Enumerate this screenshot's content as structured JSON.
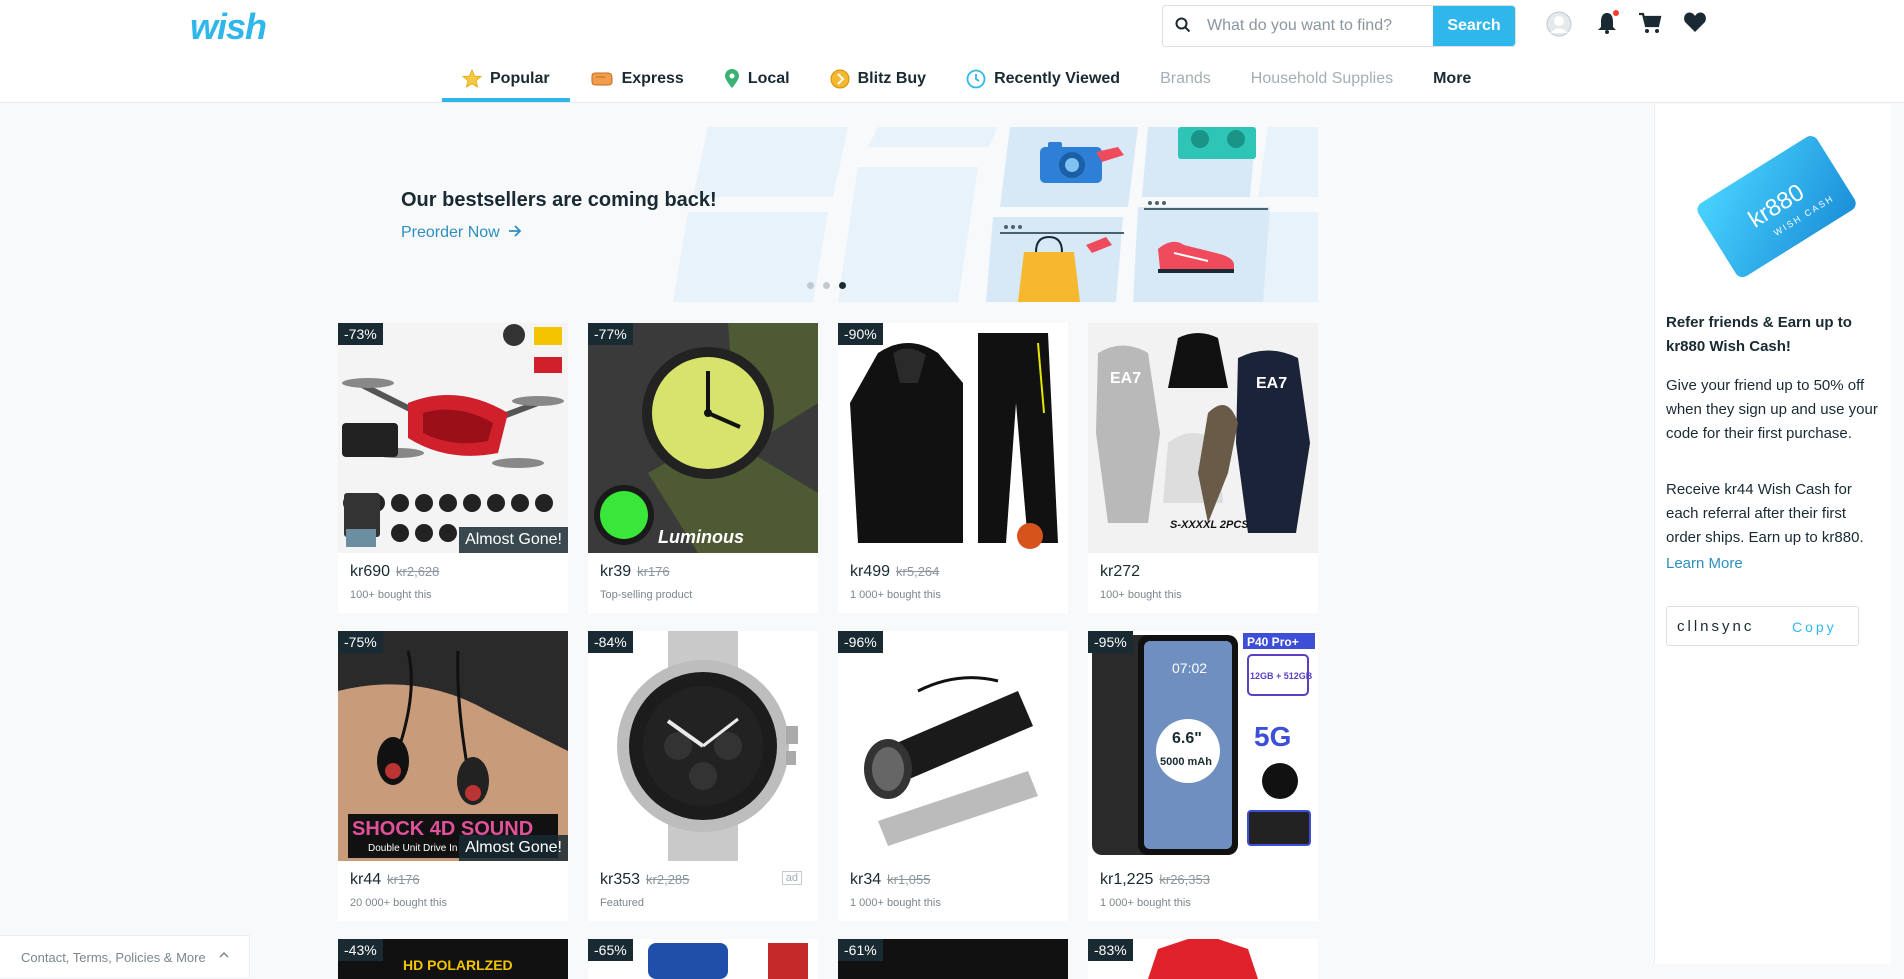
{
  "header": {
    "logo_text": "wish",
    "search_placeholder": "What do you want to find?",
    "search_button": "Search"
  },
  "nav": {
    "items": [
      {
        "label": "Popular",
        "icon": "star-icon",
        "active": true
      },
      {
        "label": "Express",
        "icon": "express-truck-icon"
      },
      {
        "label": "Local",
        "icon": "location-pin-icon"
      },
      {
        "label": "Blitz Buy",
        "icon": "blitz-coin-icon"
      },
      {
        "label": "Recently Viewed",
        "icon": "clock-icon"
      },
      {
        "label": "Brands",
        "muted": true
      },
      {
        "label": "Household Supplies",
        "muted": true
      },
      {
        "label": "More"
      }
    ]
  },
  "banner": {
    "title": "Our bestsellers are coming back!",
    "link": "Preorder Now",
    "slide_count": 3,
    "active_slide": 3
  },
  "products": [
    {
      "discount": "-73%",
      "price": "kr690",
      "original": "kr2,628",
      "sub": "100+ bought this",
      "almost_gone": "Almost Gone!",
      "image": "drone"
    },
    {
      "discount": "-77%",
      "price": "kr39",
      "original": "kr176",
      "sub": "Top-selling product",
      "image": "green-watch",
      "image_text": "Luminous"
    },
    {
      "discount": "-90%",
      "price": "kr499",
      "original": "kr5,264",
      "sub": "1 000+ bought this",
      "image": "black-jacket"
    },
    {
      "discount": "",
      "price": "kr272",
      "original": "",
      "sub": "100+ bought this",
      "image": "tracksuit",
      "image_text_top": "EA7",
      "image_text_pcs": "S-XXXXL 2PCS"
    },
    {
      "discount": "-75%",
      "price": "kr44",
      "original": "kr176",
      "sub": "20 000+ bought this",
      "almost_gone": "Almost Gone!",
      "image": "earphones",
      "image_text": "SHOCK 4D SOUND",
      "image_text_small": "Double Unit Drive In"
    },
    {
      "discount": "-84%",
      "price": "kr353",
      "original": "kr2,285",
      "sub": "Featured",
      "ad": "ad",
      "image": "silver-watch"
    },
    {
      "discount": "-96%",
      "price": "kr34",
      "original": "kr1,055",
      "sub": "1 000+ bought this",
      "image": "flashlight"
    },
    {
      "discount": "-95%",
      "price": "kr1,225",
      "original": "kr26,353",
      "sub": "1 000+ bought this",
      "image": "phone",
      "image_text_badge": "P40 Pro+",
      "image_text_mem": "12GB + 512GB",
      "image_text_screen": "6.6\"",
      "image_text_bat": "5000 mAh",
      "image_text_5g": "5G",
      "image_text_time": "07:02"
    },
    {
      "discount": "-43%",
      "image": "sunglasses",
      "image_text": "HD POLARLZED"
    },
    {
      "discount": "-65%",
      "image": "bag"
    },
    {
      "discount": "-61%",
      "image": "dark"
    },
    {
      "discount": "-83%",
      "image": "red-shirt"
    }
  ],
  "banner_art": {
    "wish_cash_amount": "kr880",
    "wish_cash_label": "WISH CASH"
  },
  "refer": {
    "title": "Refer friends & Earn up to kr880 Wish Cash!",
    "p1": "Give your friend up to 50% off when they sign up and use your code for their first purchase.",
    "p2": "Receive kr44 Wish Cash for each referral after their first order ships. Earn up to kr880.",
    "learn_more": "Learn More",
    "code": "cllnsync",
    "copy": "Copy"
  },
  "footer": {
    "label": "Contact, Terms, Policies & More"
  },
  "colors": {
    "brand": "#2fb7ec",
    "link": "#2c8fbf",
    "text": "#192a32"
  }
}
